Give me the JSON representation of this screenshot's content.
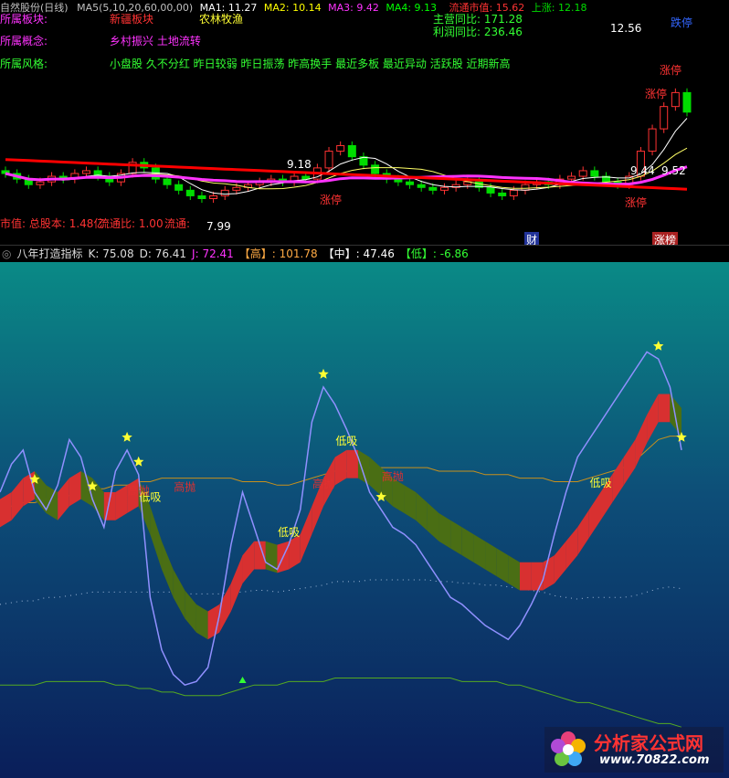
{
  "header": {
    "title_line": "自然股份(日线)",
    "ma_text": "MA5(5,10,20,60,00,00)",
    "ma1": "MA1: 11.27",
    "ma2": "MA2: 10.14",
    "ma3": "MA3: 9.42",
    "ma4": "MA4: 9.13",
    "float_value": "流通市值: 15.62",
    "rise": "上涨: 12.18"
  },
  "info": {
    "sector_label": "所属板块:",
    "sector_value1": "新疆板块",
    "sector_value2": "农林牧渔",
    "concept_label": "所属概念:",
    "concept_value": "乡村振兴 土地流转",
    "style_label": "所属风格:",
    "style_value": "小盘股 久不分红 昨日较弱 昨日振荡 昨高换手 最近多板 最近异动 活跃股 近期新高",
    "revenue_yoy": "主营同比: 171.28",
    "profit_yoy": "利润同比: 236.46",
    "market_value": "市值: 总股本: 1.48亿",
    "float_ratio": "流通比: 1.00",
    "float": "流通: "
  },
  "price_labels": {
    "high": "12.56",
    "low": "7.99",
    "mid1": "9.18",
    "mid2": "9.44",
    "mid3": "9.52",
    "limit_up_tag": "涨停",
    "limit_up_list": "涨榜",
    "fin_tag": "财",
    "dieting": "跌停"
  },
  "indicator": {
    "name": "八年打造指标",
    "k": "K: 75.08",
    "d": "D: 76.41",
    "j": "J: 72.41",
    "high": "【高】: 101.78",
    "mid": "【中】: 47.46",
    "low": "【低】: -6.86",
    "buy_label": "低吸",
    "sell_label": "高抛"
  },
  "watermark": {
    "brand": "分析家公式网",
    "url": "www.70822.com"
  },
  "colors": {
    "up": "#ff3333",
    "down": "#00dd00",
    "magenta": "#ff33ff",
    "ma_red": "#ff0000",
    "k_line": "#9090ff",
    "band_up": "#d83030",
    "band_down": "#4a6e14",
    "upper_orange": "#c8901c",
    "lower_green": "#55aa20",
    "star": "#ffff33"
  },
  "chart_data": [
    {
      "type": "line",
      "panel": "candlestick",
      "x": [
        1,
        2,
        3,
        4,
        5,
        6,
        7,
        8,
        9,
        10,
        11,
        12,
        13,
        14,
        15,
        16,
        17,
        18,
        19,
        20,
        21,
        22,
        23,
        24,
        25,
        26,
        27,
        28,
        29,
        30,
        31,
        32,
        33,
        34,
        35,
        36,
        37,
        38,
        39,
        40,
        41,
        42,
        43,
        44,
        45,
        46,
        47,
        48,
        49,
        50,
        51,
        52,
        53,
        54,
        55,
        56,
        57,
        58,
        59,
        60
      ],
      "open": [
        9.5,
        9.4,
        9.2,
        9.0,
        9.1,
        9.3,
        9.2,
        9.4,
        9.5,
        9.3,
        9.1,
        9.4,
        9.8,
        9.6,
        9.2,
        9.0,
        8.8,
        8.6,
        8.5,
        8.6,
        8.8,
        8.9,
        9.0,
        9.1,
        9.2,
        9.1,
        9.3,
        9.2,
        9.6,
        10.2,
        10.4,
        10.0,
        9.7,
        9.4,
        9.2,
        9.1,
        9.0,
        8.9,
        8.8,
        8.9,
        9.0,
        9.1,
        8.9,
        8.7,
        8.6,
        8.8,
        9.0,
        9.1,
        9.0,
        9.2,
        9.3,
        9.5,
        9.3,
        9.1,
        9.0,
        9.3,
        10.2,
        11.0,
        11.8,
        12.3
      ],
      "close": [
        9.4,
        9.2,
        9.0,
        9.1,
        9.3,
        9.2,
        9.4,
        9.5,
        9.3,
        9.1,
        9.4,
        9.8,
        9.6,
        9.2,
        9.0,
        8.8,
        8.6,
        8.5,
        8.6,
        8.8,
        8.9,
        9.0,
        9.1,
        9.2,
        9.1,
        9.3,
        9.2,
        9.6,
        10.2,
        10.4,
        10.0,
        9.7,
        9.4,
        9.2,
        9.1,
        9.0,
        8.9,
        8.8,
        8.9,
        9.0,
        9.1,
        8.9,
        8.7,
        8.6,
        8.8,
        9.0,
        9.1,
        9.0,
        9.2,
        9.3,
        9.5,
        9.3,
        9.1,
        9.0,
        9.3,
        10.2,
        11.0,
        11.8,
        12.3,
        11.6
      ],
      "ylim": [
        7.6,
        13.0
      ]
    },
    {
      "type": "line",
      "panel": "indicator",
      "series": [
        {
          "name": "K",
          "values": [
            60,
            68,
            72,
            60,
            55,
            62,
            75,
            70,
            58,
            50,
            66,
            72,
            65,
            30,
            15,
            8,
            5,
            6,
            10,
            25,
            45,
            60,
            50,
            40,
            38,
            45,
            55,
            80,
            90,
            85,
            78,
            70,
            60,
            55,
            50,
            48,
            45,
            40,
            35,
            30,
            28,
            25,
            22,
            20,
            18,
            22,
            28,
            35,
            48,
            60,
            70,
            75,
            80,
            85,
            90,
            95,
            100,
            98,
            90,
            72
          ]
        },
        {
          "name": "D",
          "values": [
            58,
            60,
            64,
            66,
            62,
            60,
            64,
            66,
            64,
            60,
            60,
            62,
            64,
            56,
            46,
            38,
            32,
            28,
            26,
            28,
            34,
            42,
            46,
            46,
            45,
            46,
            48,
            56,
            64,
            70,
            72,
            72,
            70,
            67,
            64,
            62,
            60,
            57,
            54,
            52,
            50,
            48,
            46,
            44,
            42,
            40,
            40,
            40,
            42,
            46,
            50,
            55,
            60,
            65,
            70,
            75,
            82,
            88,
            88,
            84
          ]
        }
      ],
      "upper": [
        55,
        56,
        57,
        57,
        58,
        58,
        59,
        60,
        61,
        61,
        62,
        62,
        63,
        63,
        64,
        64,
        64,
        64,
        64,
        64,
        64,
        63,
        63,
        63,
        62,
        62,
        63,
        64,
        65,
        66,
        66,
        66,
        67,
        67,
        67,
        67,
        67,
        67,
        66,
        66,
        66,
        66,
        65,
        65,
        65,
        64,
        64,
        64,
        63,
        63,
        63,
        64,
        65,
        66,
        67,
        69,
        72,
        75,
        76,
        76
      ],
      "lower": [
        5,
        5,
        5,
        5,
        6,
        6,
        6,
        6,
        6,
        6,
        5,
        5,
        4,
        4,
        3,
        3,
        2,
        2,
        2,
        2,
        3,
        4,
        5,
        5,
        5,
        6,
        6,
        6,
        6,
        7,
        7,
        7,
        7,
        7,
        7,
        7,
        7,
        7,
        7,
        7,
        6,
        6,
        6,
        6,
        5,
        5,
        4,
        3,
        2,
        1,
        0,
        0,
        -1,
        -2,
        -3,
        -4,
        -5,
        -6,
        -6,
        -7
      ],
      "ylim": [
        -15,
        110
      ]
    }
  ]
}
